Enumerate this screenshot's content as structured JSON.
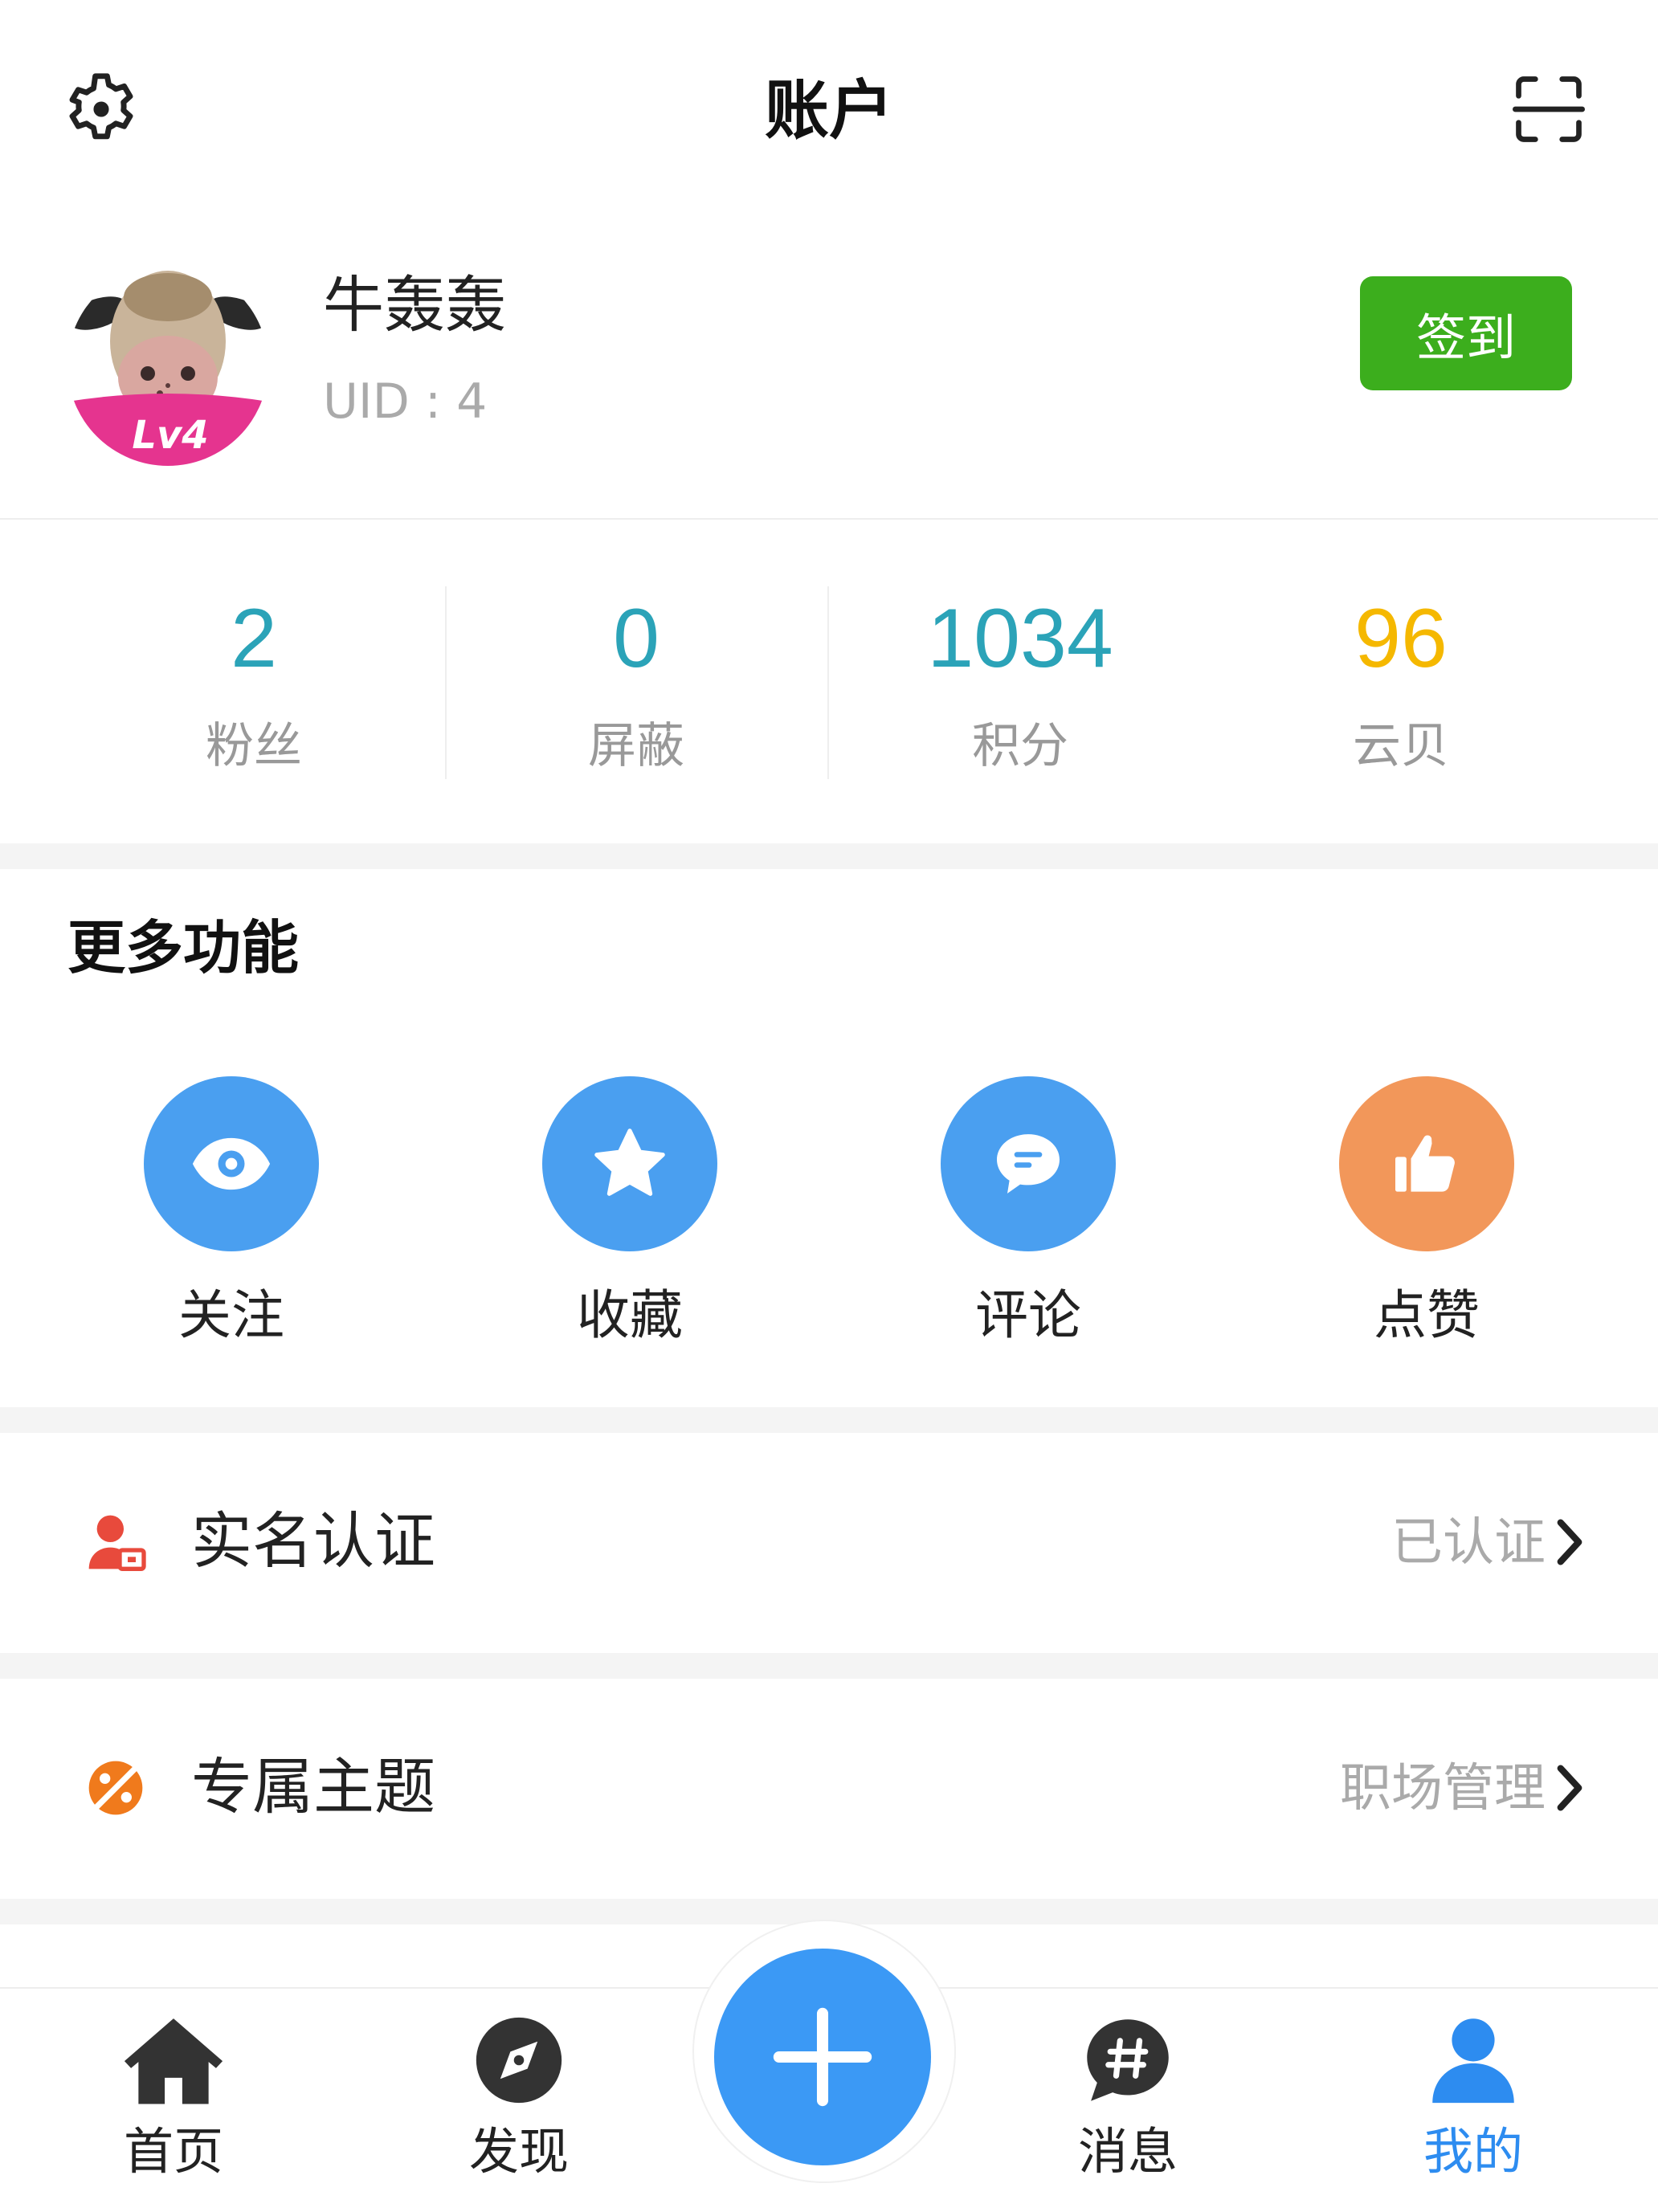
{
  "header": {
    "title": "账户",
    "settings_icon": "gear-icon",
    "scan_icon": "scan-icon"
  },
  "profile": {
    "name": "牛轰轰",
    "uid": "UID : 4",
    "level_badge": "Lv4",
    "checkin_label": "签到"
  },
  "stats": [
    {
      "value": "2",
      "label": "粉丝",
      "color": "#2ba3b8"
    },
    {
      "value": "0",
      "label": "屏蔽",
      "color": "#2ba3b8"
    },
    {
      "value": "1034",
      "label": "积分",
      "color": "#2ba3b8"
    },
    {
      "value": "96",
      "label": "云贝",
      "color": "#f5b800"
    }
  ],
  "more": {
    "title": "更多功能",
    "items": [
      {
        "label": "关注",
        "icon": "eye-icon",
        "color": "#4a9ff0"
      },
      {
        "label": "收藏",
        "icon": "star-icon",
        "color": "#4a9ff0"
      },
      {
        "label": "评论",
        "icon": "comment-icon",
        "color": "#4a9ff0"
      },
      {
        "label": "点赞",
        "icon": "thumbs-up-icon",
        "color": "#f2975a"
      }
    ]
  },
  "rows": [
    {
      "label": "实名认证",
      "value": "已认证",
      "icon": "id-verify-icon",
      "color": "#e84a3c"
    },
    {
      "label": "专属主题",
      "value": "职场管理",
      "icon": "theme-icon",
      "color": "#f07a1c"
    }
  ],
  "tabbar": {
    "items": [
      {
        "label": "首页",
        "icon": "home-icon"
      },
      {
        "label": "发现",
        "icon": "compass-icon"
      },
      {
        "label": "消息",
        "icon": "message-icon"
      },
      {
        "label": "我的",
        "icon": "user-icon"
      }
    ],
    "active_color": "#2d8cf0",
    "fab_icon": "plus-icon"
  }
}
